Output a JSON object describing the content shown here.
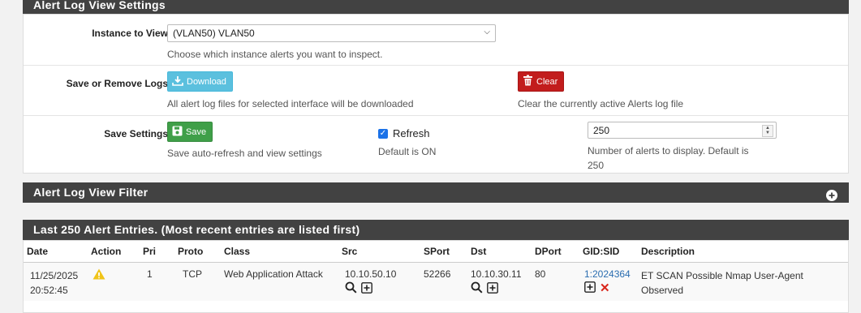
{
  "settings": {
    "title": "Alert Log View Settings",
    "instance": {
      "label": "Instance to View",
      "selected": "(VLAN50) VLAN50",
      "help": "Choose which instance alerts you want to inspect."
    },
    "logs": {
      "label": "Save or Remove Logs",
      "download_label": "Download",
      "download_help": "All alert log files for selected interface will be downloaded",
      "clear_label": "Clear",
      "clear_help": "Clear the currently active Alerts log file"
    },
    "save": {
      "label": "Save Settings",
      "save_label": "Save",
      "save_help": "Save auto-refresh and view settings",
      "refresh_label": "Refresh",
      "refresh_checked": true,
      "refresh_help": "Default is ON",
      "alerts_count": "250",
      "alerts_help_line1": "Number of alerts to display. Default is",
      "alerts_help_line2": "250"
    }
  },
  "filter": {
    "title": "Alert Log View Filter",
    "expand_icon": "plus-circle-icon"
  },
  "entries": {
    "title": "Last 250 Alert Entries. (Most recent entries are listed first)",
    "columns": [
      "Date",
      "Action",
      "Pri",
      "Proto",
      "Class",
      "Src",
      "SPort",
      "Dst",
      "DPort",
      "GID:SID",
      "Description"
    ],
    "rows": [
      {
        "date_line1": "11/25/2025",
        "date_line2": "20:52:45",
        "action_icon": "warning-icon",
        "pri": "1",
        "proto": "TCP",
        "class": "Web Application Attack",
        "src": "10.10.50.10",
        "sport": "52266",
        "dst": "10.10.30.11",
        "dport": "80",
        "gid_sid": "1:2024364",
        "description_line1": "ET SCAN Possible Nmap User-Agent",
        "description_line2": "Observed"
      }
    ]
  },
  "colors": {
    "header_bg": "#424242",
    "info": "#5bc0de",
    "danger": "#c21d1d",
    "success": "#3f9f48",
    "link": "#2a6db0",
    "warning": "#f0c419"
  }
}
